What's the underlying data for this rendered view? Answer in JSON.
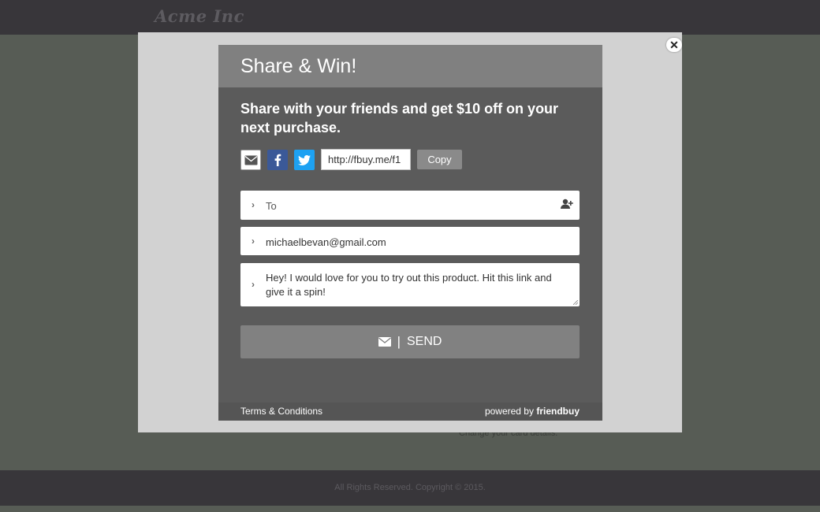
{
  "page": {
    "logo": "Acme Inc",
    "behind_text": "Change your card details.",
    "footer_text": "All Rights Reserved. Copyright © 2015."
  },
  "overlay": {
    "close_icon": "close-icon"
  },
  "modal": {
    "title": "Share & Win!",
    "subhead": "Share with your friends and get $10 off on your next purchase.",
    "share_icons": [
      "envelope-icon",
      "facebook-icon",
      "twitter-icon"
    ],
    "link_value": "http://fbuy.me/f1",
    "copy_label": "Copy",
    "to_placeholder": "To",
    "from_value": "michaelbevan@gmail.com",
    "message_value": "Hey! I would love for you to try out this product. Hit this link and give it a spin!",
    "send_separator": "|",
    "send_label": "SEND",
    "terms_label": "Terms & Conditions",
    "powered_prefix": "powered by",
    "powered_brand": "friendbuy"
  },
  "colors": {
    "facebook": "#3b5998",
    "twitter": "#1da1f2",
    "header": "#808080",
    "send_button": "#818181"
  }
}
